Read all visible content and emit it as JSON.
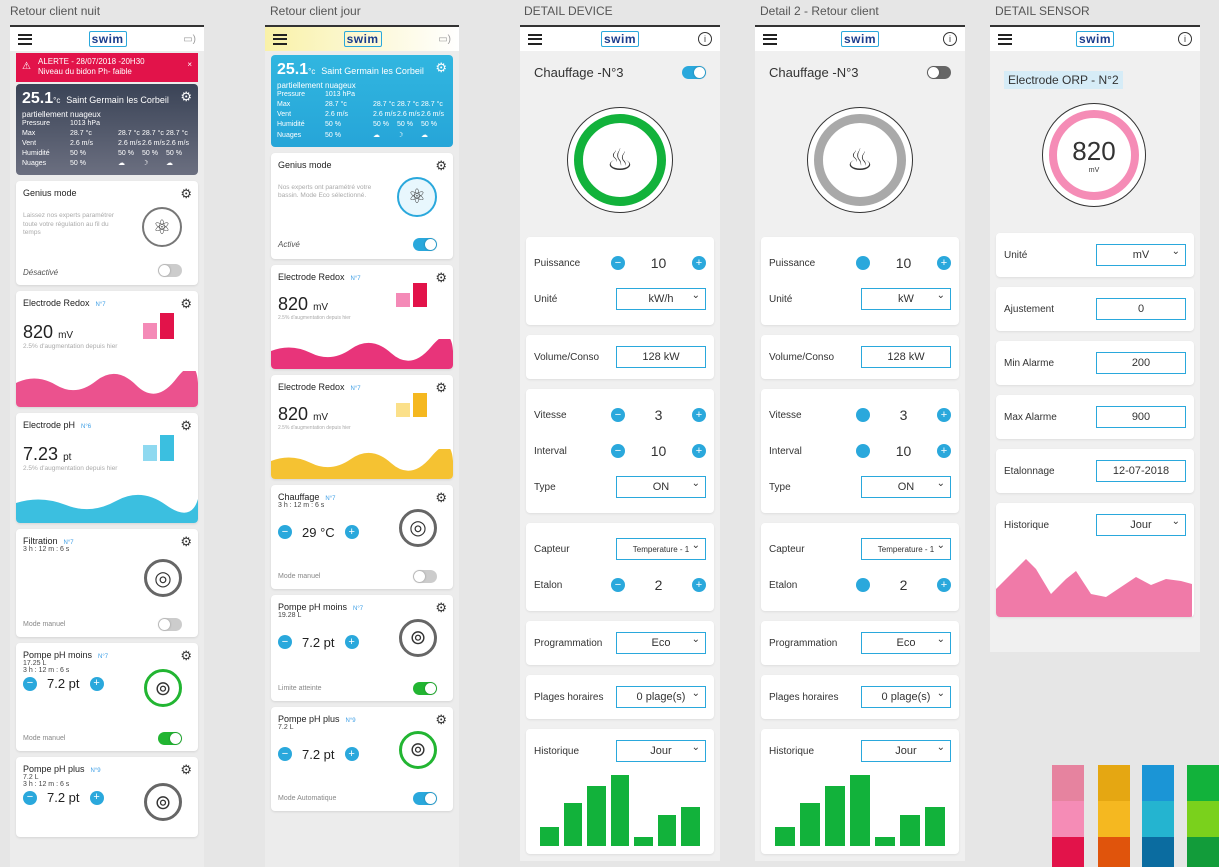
{
  "labels": {
    "a1": "Retour client nuit",
    "a2": "Retour client jour",
    "a3": "DETAIL DEVICE",
    "a4": "Detail 2 - Retour client",
    "a5": "DETAIL SENSOR"
  },
  "logo": "swim",
  "logo_box": "a",
  "alert": {
    "title": "ALERTE - 28/07/2018 -20H30",
    "text": "Niveau du bidon Ph- faible"
  },
  "weather": {
    "temp": "25.1",
    "unit": "°c",
    "city": "Saint Germain les Corbeil",
    "desc": "partiellement nuageux",
    "cols": [
      "Mon 23h",
      "Mon 00h",
      "Tues 03h"
    ],
    "rows": [
      [
        "Pressure",
        "1013 hPa",
        "",
        "",
        ""
      ],
      [
        "Max",
        "28.7 °c",
        "28.7 °c",
        "28.7 °c",
        "28.7 °c"
      ],
      [
        "Vent",
        "2.6 m/s",
        "2.6 m/s",
        "2.6 m/s",
        "2.6 m/s"
      ],
      [
        "Humidité",
        "50 %",
        "50 %",
        "50 %",
        "50 %"
      ],
      [
        "Nuages",
        "50 %",
        "☁",
        "☽",
        "☁"
      ]
    ]
  },
  "genius": {
    "title": "Genius mode",
    "night_text": "Laissez nos experts paramétrer toute votre régulation au fil du temps",
    "day_text": "Nos experts ont paramétré votre bassin. Mode Eco sélectionné.",
    "off": "Désactivé",
    "on": "Activé"
  },
  "redox": {
    "title": "Electrode Redox",
    "no": "N°7",
    "value": "820",
    "unit": "mV",
    "note": "2.5% d'augmentation depuis hier",
    "b1": "789",
    "b2": "835"
  },
  "ph": {
    "title": "Electrode pH",
    "no": "N°6",
    "value": "7.23",
    "unit": "pt",
    "b1": "7.11",
    "b2": "7.34"
  },
  "filtration": {
    "title": "Filtration",
    "no": "N°7",
    "time": "3 h : 12 m : 6 s",
    "mode": "Mode manuel"
  },
  "chauffage": {
    "title": "Chauffage",
    "no": "N°7",
    "time": "3 h : 12 m : 6 s",
    "value": "29 °C",
    "mode": "Mode manuel"
  },
  "pumpmoins": {
    "title": "Pompe pH moins",
    "no": "N°7",
    "vol": "17.25 L",
    "vol2": "19.28 L",
    "time": "3 h : 12 m : 6 s",
    "value": "7.2 pt",
    "mode": "Mode manuel",
    "limit": "Limite atteinte"
  },
  "pumpplus": {
    "title": "Pompe pH plus",
    "no": "N°9",
    "vol": "7.2 L",
    "time": "3 h : 12 m : 6 s",
    "value": "7.2 pt",
    "mode": "Mode Automatique"
  },
  "device": {
    "title": "Chauffage -N°3",
    "puissance": "Puissance",
    "p_val": "10",
    "unite": "Unité",
    "unit_val": "kW/h",
    "unit_val2": "kW",
    "volume": "Volume/Conso",
    "vol_val": "128 kW",
    "vitesse": "Vitesse",
    "vit_val": "3",
    "interval": "Interval",
    "int_val": "10",
    "type": "Type",
    "type_val": "ON",
    "capteur": "Capteur",
    "capt_val": "Temperature - 1",
    "etalon": "Etalon",
    "et_val": "2",
    "prog": "Programmation",
    "prog_val": "Eco",
    "plages": "Plages horaires",
    "plages_val": "0 plage(s)",
    "hist": "Historique",
    "hist_val": "Jour"
  },
  "sensor": {
    "title": "Electrode ORP - N°2",
    "value": "820",
    "unit": "mV",
    "unite": "Unité",
    "unite_val": "mV",
    "ajust": "Ajustement",
    "ajust_val": "0",
    "min": "Min Alarme",
    "min_val": "200",
    "max": "Max Alarme",
    "max_val": "900",
    "etal": "Etalonnage",
    "etal_val": "12-07-2018",
    "hist": "Historique",
    "hist_val": "Jour"
  },
  "colors": {
    "blue": "#2aa8dc",
    "pink": "#e8347a",
    "green": "#22b532",
    "yellow": "#f5c232",
    "cyan": "#3bbfe0"
  }
}
